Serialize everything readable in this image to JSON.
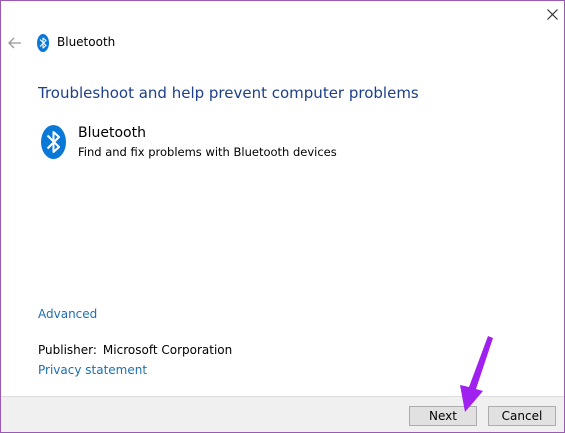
{
  "window": {
    "title": "Bluetooth"
  },
  "main": {
    "heading": "Troubleshoot and help prevent computer problems",
    "troubleshooter": {
      "title": "Bluetooth",
      "description": "Find and fix problems with Bluetooth devices"
    },
    "advanced_link": "Advanced",
    "publisher": {
      "label": "Publisher:",
      "value": "Microsoft Corporation"
    },
    "privacy_link": "Privacy statement"
  },
  "footer": {
    "next_label": "Next",
    "cancel_label": "Cancel"
  },
  "icons": {
    "close": "close-icon",
    "back": "back-arrow-icon",
    "bluetooth": "bluetooth-icon",
    "annotation": "purple-arrow-annotation"
  },
  "colors": {
    "heading": "#1e3f8a",
    "link": "#1a6fb3",
    "bluetooth_blue": "#0a78d7",
    "annotation_purple": "#a020f0",
    "window_border": "#9b59b6"
  }
}
